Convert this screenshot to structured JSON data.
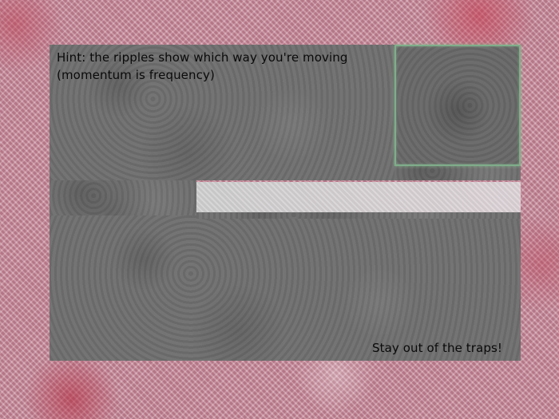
{
  "hints": {
    "line1": "Hint: the ripples show which way you're moving",
    "line2": "(momentum is frequency)",
    "trap_warning": "Stay out of the traps!"
  },
  "colors": {
    "background": "#c98f9f",
    "stone": "#6f6f6f",
    "goal_border": "#7fae8a",
    "text": "#0a0a0a"
  }
}
